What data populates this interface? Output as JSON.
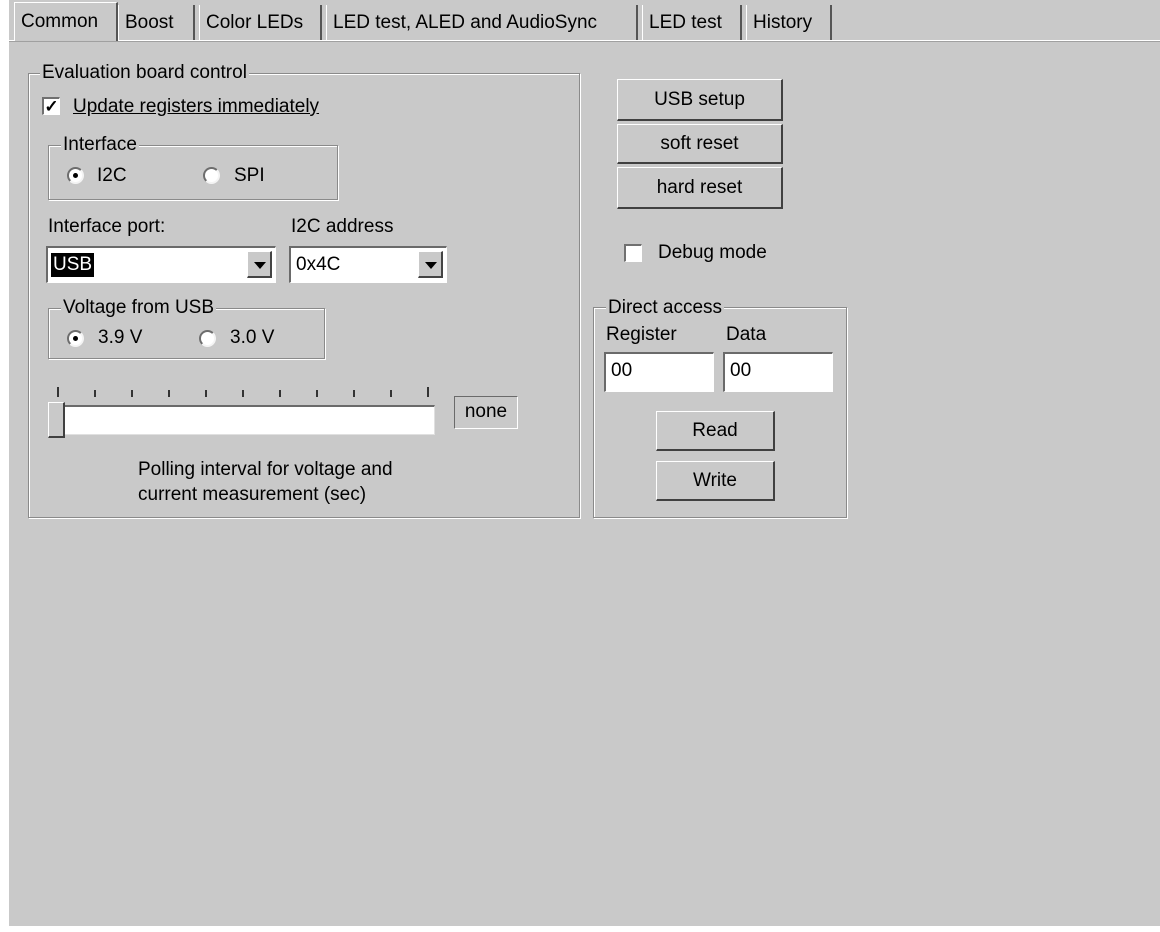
{
  "tabs": [
    {
      "label": "Common",
      "active": true
    },
    {
      "label": "Boost",
      "active": false
    },
    {
      "label": "Color LEDs",
      "active": false
    },
    {
      "label": "LED test, ALED and AudioSync",
      "active": false
    },
    {
      "label": "LED test",
      "active": false
    },
    {
      "label": "History",
      "active": false
    }
  ],
  "eval_board": {
    "title": "Evaluation board control",
    "update_immediately": {
      "label": "Update registers immediately",
      "checked": true
    },
    "interface": {
      "title": "Interface",
      "options": [
        {
          "label": "I2C",
          "selected": true
        },
        {
          "label": "SPI",
          "selected": false
        }
      ]
    },
    "interface_port": {
      "label": "Interface port:",
      "value": "USB"
    },
    "i2c_address": {
      "label": "I2C address",
      "value": "0x4C"
    },
    "voltage": {
      "title": "Voltage from USB",
      "options": [
        {
          "label": "3.9 V",
          "selected": true
        },
        {
          "label": "3.0 V",
          "selected": false
        }
      ]
    },
    "polling": {
      "readout": "none",
      "caption_line1": "Polling interval for voltage and",
      "caption_line2": "current measurement (sec)",
      "position_fraction": 0.0
    }
  },
  "actions": {
    "usb_setup": "USB setup",
    "soft_reset": "soft reset",
    "hard_reset": "hard reset"
  },
  "debug_mode": {
    "label": "Debug mode",
    "checked": false
  },
  "direct_access": {
    "title": "Direct access",
    "register_label": "Register",
    "data_label": "Data",
    "register_value": "00",
    "data_value": "00",
    "read_label": "Read",
    "write_label": "Write"
  },
  "colors": {
    "background": "#c9c9c9",
    "field": "#ffffff"
  }
}
